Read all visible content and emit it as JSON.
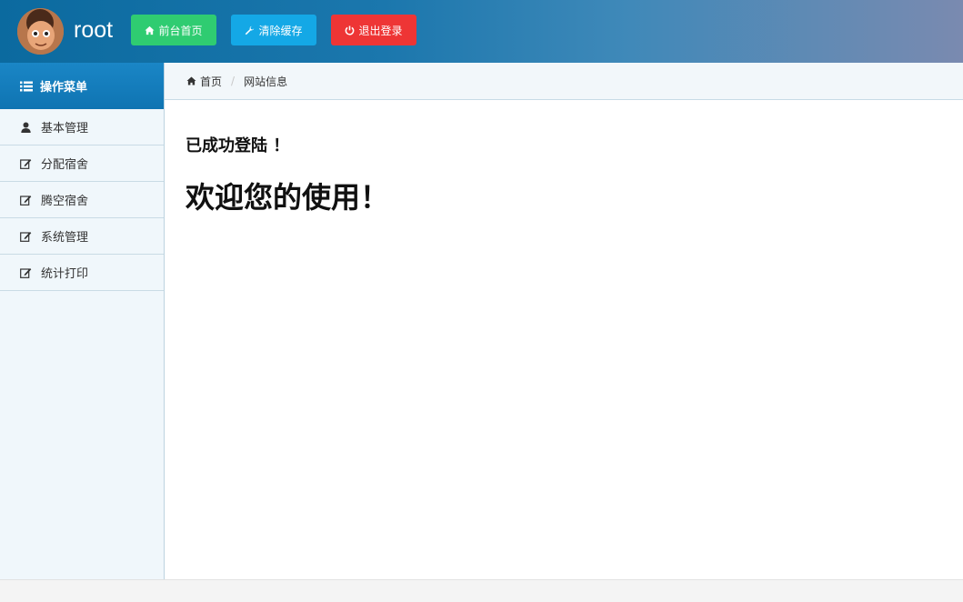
{
  "header": {
    "username": "root",
    "buttons": {
      "home_label": "前台首页",
      "clear_cache_label": "清除缓存",
      "logout_label": "退出登录"
    },
    "colors": {
      "home": "#2fcc71",
      "clear_cache": "#14a8e6",
      "logout": "#ee3535"
    }
  },
  "sidebar": {
    "title": "操作菜单",
    "items": [
      {
        "label": "基本管理",
        "icon": "user-icon"
      },
      {
        "label": "分配宿舍",
        "icon": "edit-icon"
      },
      {
        "label": "腾空宿舍",
        "icon": "edit-icon"
      },
      {
        "label": "系统管理",
        "icon": "edit-icon"
      },
      {
        "label": "统计打印",
        "icon": "edit-icon"
      }
    ]
  },
  "breadcrumb": {
    "home": "首页",
    "separator": "/",
    "current": "网站信息"
  },
  "main": {
    "login_message": "已成功登陆 ！",
    "welcome_message": "欢迎您的使用！"
  }
}
